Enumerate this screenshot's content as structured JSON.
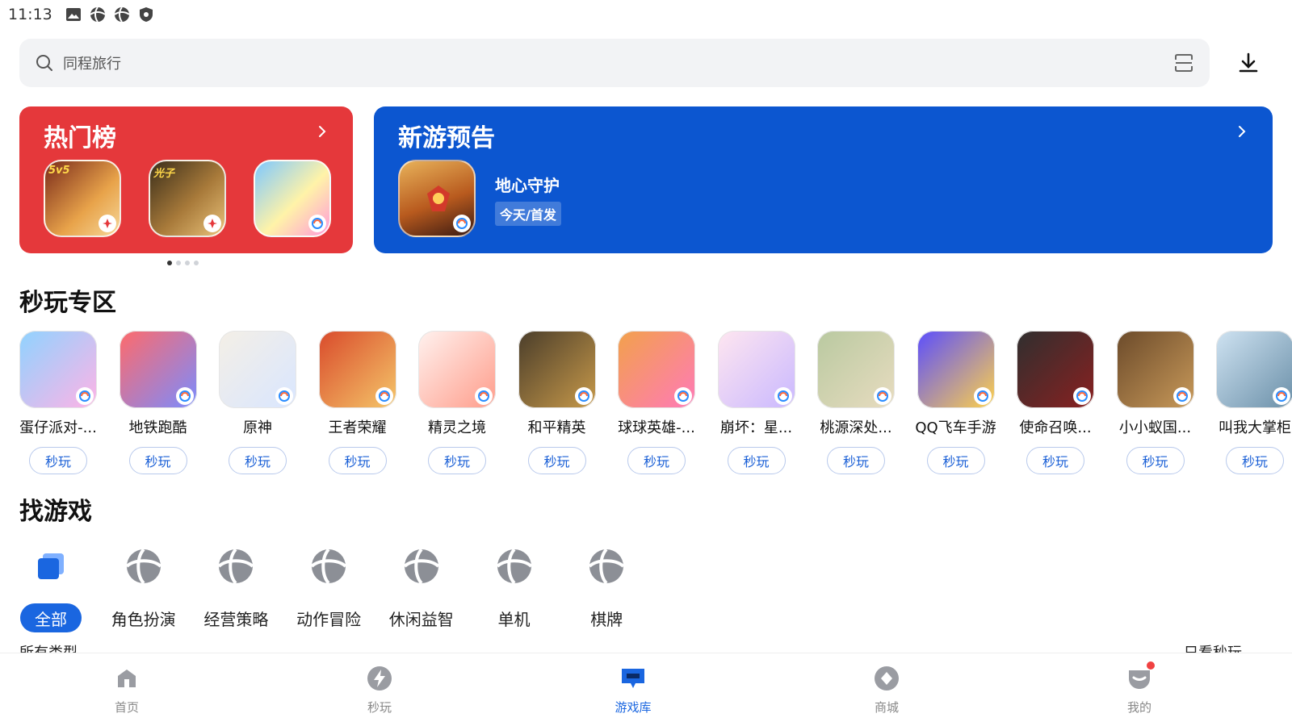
{
  "status_bar": {
    "time": "11:13",
    "icons": [
      "image-icon",
      "game-center-icon",
      "game-center-icon",
      "shield-icon"
    ]
  },
  "search": {
    "placeholder": "同程旅行",
    "icon": "search-icon",
    "scan_icon": "scan-icon"
  },
  "header": {
    "download_icon": "download-icon"
  },
  "hot_list": {
    "title": "热门榜",
    "apps": [
      "王者荣耀",
      "和平精英",
      "蛋仔派对"
    ],
    "pages": 4,
    "active_page": 1
  },
  "new_game": {
    "title": "新游预告",
    "game_name": "地心守护",
    "tag": "今天/首发"
  },
  "quick_play": {
    "title": "秒玩专区",
    "play_label": "秒玩",
    "items": [
      {
        "name": "蛋仔派对-...",
        "color1": "#8fd3ff",
        "color2": "#ffb3e6"
      },
      {
        "name": "地铁跑酷",
        "color1": "#ff6a6a",
        "color2": "#7a8cff"
      },
      {
        "name": "原神",
        "color1": "#f4efe6",
        "color2": "#d9e6ff"
      },
      {
        "name": "王者荣耀",
        "color1": "#d94a2b",
        "color2": "#f5c76a"
      },
      {
        "name": "精灵之境",
        "color1": "#fff2ef",
        "color2": "#ff9c8a"
      },
      {
        "name": "和平精英",
        "color1": "#4a3d2a",
        "color2": "#c89a4a"
      },
      {
        "name": "球球英雄-...",
        "color1": "#f2a14b",
        "color2": "#ff7ab8"
      },
      {
        "name": "崩坏：星...",
        "color1": "#ffe6f0",
        "color2": "#c9b8ff"
      },
      {
        "name": "桃源深处...",
        "color1": "#b9c9a0",
        "color2": "#e8dcc0"
      },
      {
        "name": "QQ飞车手游",
        "color1": "#5a4dff",
        "color2": "#ffd24a"
      },
      {
        "name": "使命召唤...",
        "color1": "#2f2f2f",
        "color2": "#8a2020"
      },
      {
        "name": "小小蚁国...",
        "color1": "#6b4a2a",
        "color2": "#c99a5a"
      },
      {
        "name": "叫我大掌柜",
        "color1": "#cfe3f2",
        "color2": "#6a8fa8"
      }
    ]
  },
  "find_game": {
    "title": "找游戏",
    "categories": [
      "全部",
      "角色扮演",
      "经营策略",
      "动作冒险",
      "休闲益智",
      "单机",
      "棋牌"
    ],
    "active": 0,
    "next_section_title": "所有类型",
    "next_section_right": "只看秒玩"
  },
  "bottom_nav": {
    "items": [
      {
        "label": "首页",
        "icon": "home-icon"
      },
      {
        "label": "秒玩",
        "icon": "lightning-icon"
      },
      {
        "label": "游戏库",
        "icon": "library-icon"
      },
      {
        "label": "商城",
        "icon": "store-icon"
      },
      {
        "label": "我的",
        "icon": "profile-icon"
      }
    ],
    "active": 2
  },
  "colors": {
    "hot_bg": "#e5383b",
    "new_game_bg": "#0c56d0",
    "accent": "#1a66e0"
  }
}
